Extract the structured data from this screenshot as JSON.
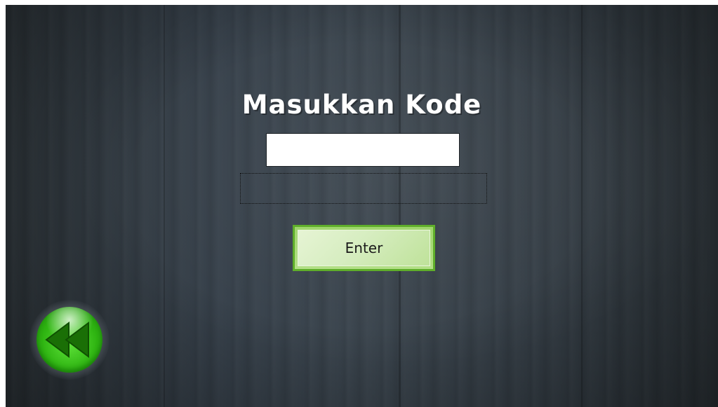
{
  "screen": {
    "title": "Masukkan Kode"
  },
  "code_input": {
    "value": "",
    "placeholder": ""
  },
  "message": {
    "text": ""
  },
  "buttons": {
    "enter_label": "Enter",
    "back_icon": "rewind-icon"
  },
  "colors": {
    "background": "#343d45",
    "enter_button": "#b3df86",
    "back_button": "#2fb512",
    "title_text": "#ffffff"
  }
}
